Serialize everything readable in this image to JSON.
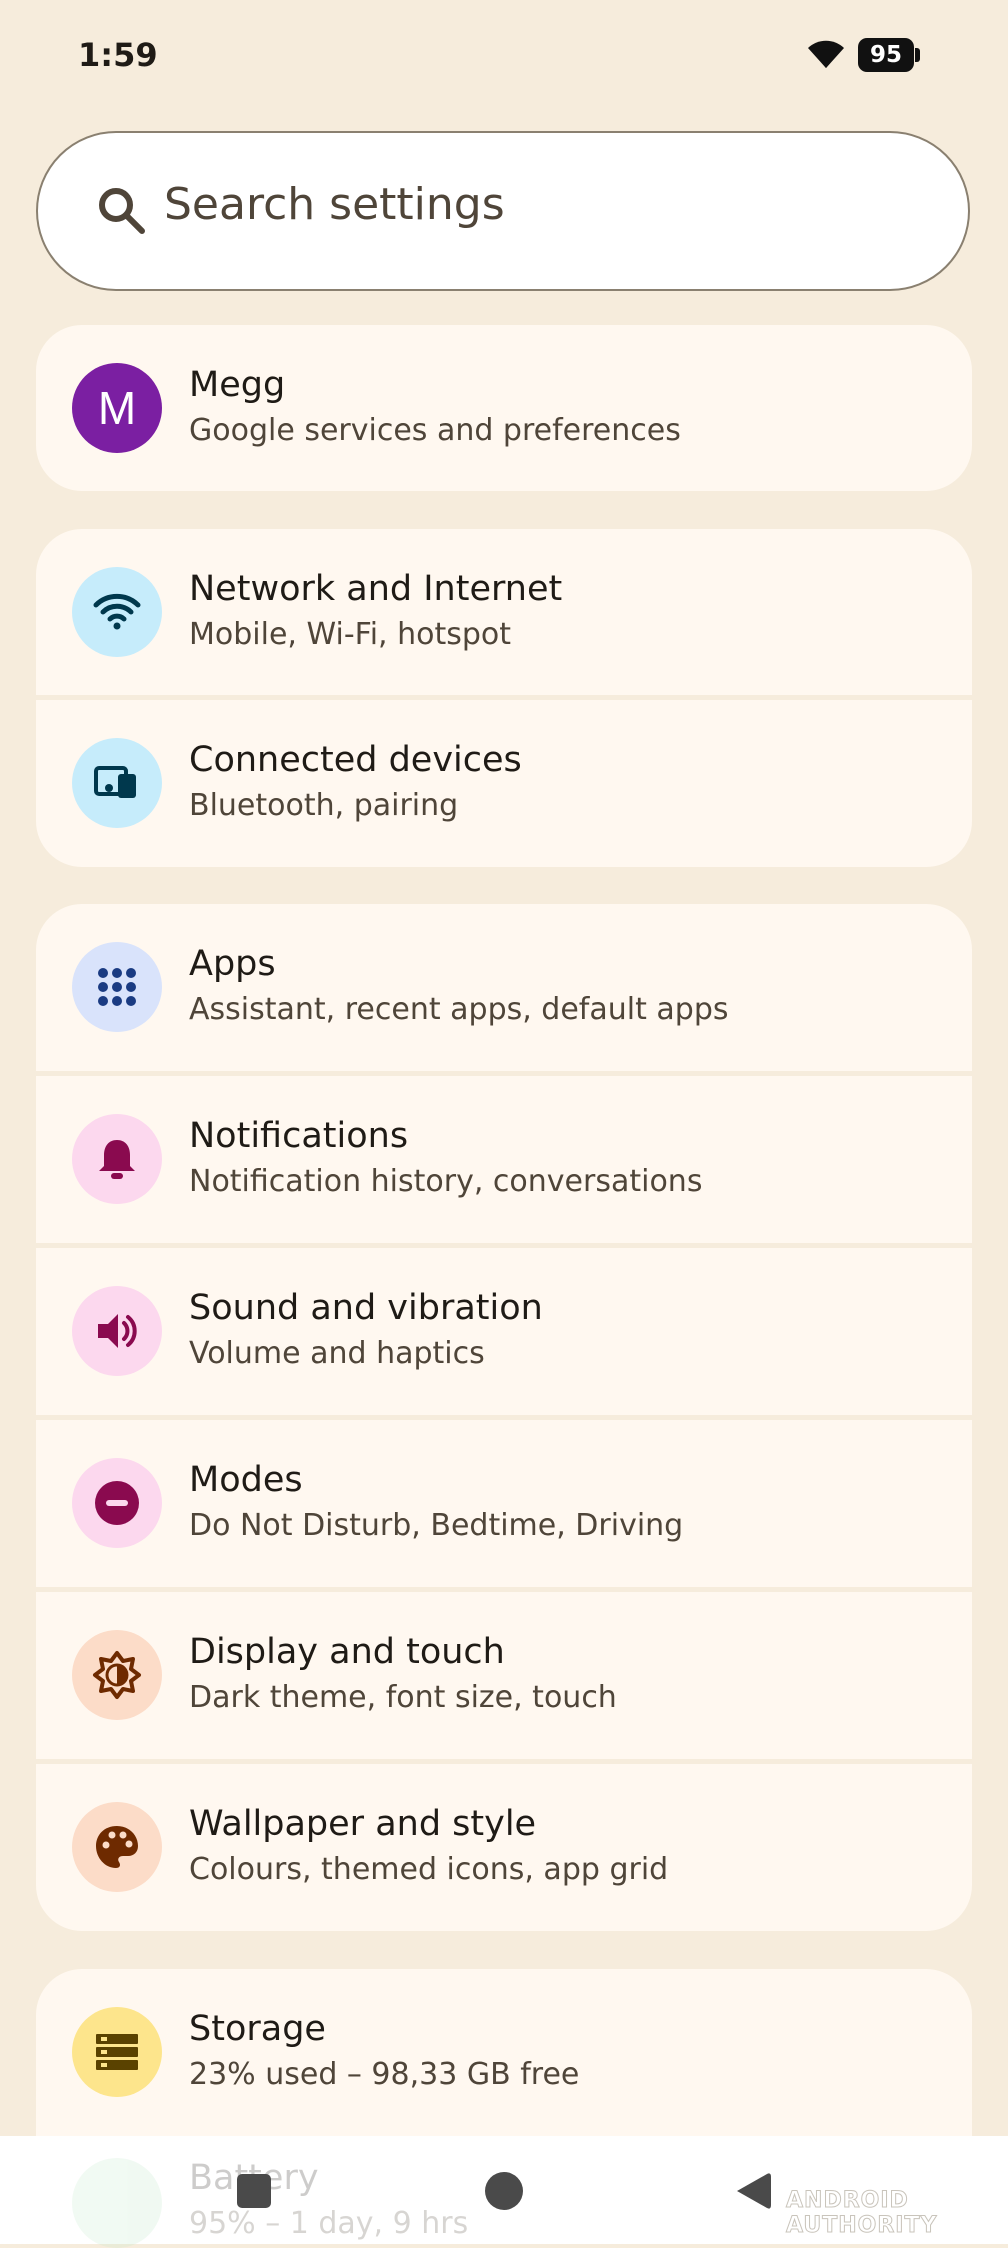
{
  "status_bar": {
    "time": "1:59",
    "battery": "95"
  },
  "search": {
    "placeholder": "Search settings"
  },
  "account": {
    "initial": "M",
    "name": "Megg",
    "subtitle": "Google services and preferences",
    "avatar_color": "#7b1fa2"
  },
  "groups": [
    {
      "items": [
        {
          "title": "Network and Internet",
          "subtitle": "Mobile, Wi-Fi, hotspot",
          "icon": "wifi-icon",
          "bg": "#c6ecfb",
          "fg": "#00384d"
        },
        {
          "title": "Connected devices",
          "subtitle": "Bluetooth, pairing",
          "icon": "devices-icon",
          "bg": "#c6ecfb",
          "fg": "#00384d"
        }
      ]
    },
    {
      "items": [
        {
          "title": "Apps",
          "subtitle": "Assistant, recent apps, default apps",
          "icon": "apps-grid-icon",
          "bg": "#d9e3fb",
          "fg": "#1a3b82"
        },
        {
          "title": "Notifications",
          "subtitle": "Notification history, conversations",
          "icon": "bell-icon",
          "bg": "#fcd8ee",
          "fg": "#8a0a4f"
        },
        {
          "title": "Sound and vibration",
          "subtitle": "Volume and haptics",
          "icon": "speaker-icon",
          "bg": "#fcd8ee",
          "fg": "#8a0a4f"
        },
        {
          "title": "Modes",
          "subtitle": "Do Not Disturb, Bedtime, Driving",
          "icon": "dnd-icon",
          "bg": "#fcd8ee",
          "fg": "#8a0a4f"
        },
        {
          "title": "Display and touch",
          "subtitle": "Dark theme, font size, touch",
          "icon": "brightness-icon",
          "bg": "#fcdcc8",
          "fg": "#6e2a00"
        },
        {
          "title": "Wallpaper and style",
          "subtitle": "Colours, themed icons, app grid",
          "icon": "palette-icon",
          "bg": "#fcdcc8",
          "fg": "#6e2a00"
        }
      ]
    },
    {
      "items": [
        {
          "title": "Storage",
          "subtitle": "23% used – 98,33 GB free",
          "icon": "storage-icon",
          "bg": "#fde58c",
          "fg": "#5a4200"
        }
      ]
    }
  ],
  "peek": {
    "title": "Battery",
    "subtitle": "95% – 1 day, 9 hrs"
  },
  "watermark": "ANDROID AUTHORITY",
  "colors": {
    "background": "#f6ecdc",
    "card": "#fff8f0"
  }
}
